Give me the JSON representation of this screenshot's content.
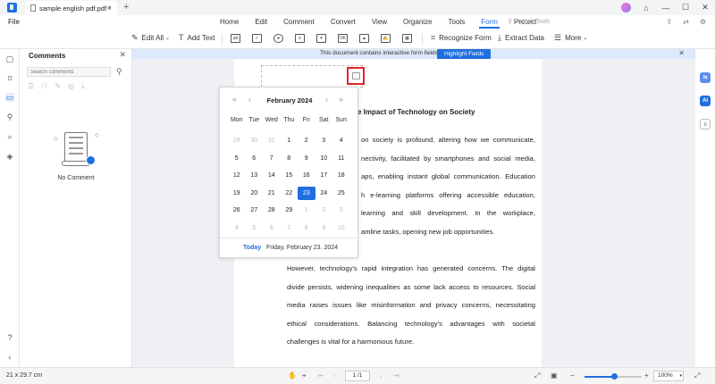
{
  "titlebar": {
    "tab_name": "sample english pdf.pdf *",
    "tab_close": "×",
    "new_tab": "+",
    "min": "—",
    "max": "☐",
    "close": "✕"
  },
  "menubar": {
    "file": "File",
    "items": [
      "Home",
      "Edit",
      "Comment",
      "Convert",
      "View",
      "Organize",
      "Tools",
      "Form",
      "Protect"
    ],
    "active": "Form",
    "search_tools": "Search Tools"
  },
  "toolbar": {
    "edit_all": "Edit All",
    "add_text": "Add Text",
    "recognize_form": "Recognize Form",
    "extract_data": "Extract Data",
    "more": "More"
  },
  "comments_panel": {
    "title": "Comments",
    "search_placeholder": "Search comments",
    "empty_text": "No Comment"
  },
  "infobar": {
    "message": "This document contains interactive form fields.",
    "button": "Highlight Fields"
  },
  "document": {
    "title_fragment": "e Impact of Technology on Society",
    "para1_lines": [
      "on society is profound, altering how we communicate,",
      "nectivity, facilitated by smartphones and social media,",
      "aps, enabling instant global communication. Education",
      "h e-learning platforms offering accessible education,",
      "learning and skill development. In the workplace,",
      "amline tasks, opening new job opportunities."
    ],
    "para2_lines": [
      "However, technology's rapid integration has generated concerns. The digital",
      "divide persists, widening inequalities as some lack access to resources. Social",
      "media raises issues like misinformation and privacy concerns, necessitating",
      "ethical considerations. Balancing technology's advantages with societal",
      "challenges is vital for a harmonious future."
    ]
  },
  "calendar": {
    "month_label": "February 2024",
    "prev_year": "«",
    "prev_month": "‹",
    "next_month": "›",
    "next_year": "»",
    "weekdays": [
      "Mon",
      "Tue",
      "Wed",
      "Thu",
      "Fri",
      "Sat",
      "Sun"
    ],
    "weeks": [
      [
        {
          "d": "29",
          "o": true
        },
        {
          "d": "30",
          "o": true
        },
        {
          "d": "31",
          "o": true
        },
        {
          "d": "1"
        },
        {
          "d": "2"
        },
        {
          "d": "3"
        },
        {
          "d": "4"
        }
      ],
      [
        {
          "d": "5"
        },
        {
          "d": "6"
        },
        {
          "d": "7"
        },
        {
          "d": "8"
        },
        {
          "d": "9"
        },
        {
          "d": "10"
        },
        {
          "d": "11"
        }
      ],
      [
        {
          "d": "12"
        },
        {
          "d": "13"
        },
        {
          "d": "14"
        },
        {
          "d": "15"
        },
        {
          "d": "16"
        },
        {
          "d": "17"
        },
        {
          "d": "18"
        }
      ],
      [
        {
          "d": "19"
        },
        {
          "d": "20"
        },
        {
          "d": "21"
        },
        {
          "d": "22"
        },
        {
          "d": "23",
          "s": true
        },
        {
          "d": "24"
        },
        {
          "d": "25"
        }
      ],
      [
        {
          "d": "26"
        },
        {
          "d": "27"
        },
        {
          "d": "28"
        },
        {
          "d": "29"
        },
        {
          "d": "1",
          "o": true
        },
        {
          "d": "2",
          "o": true
        },
        {
          "d": "3",
          "o": true
        }
      ],
      [
        {
          "d": "4",
          "o": true
        },
        {
          "d": "5",
          "o": true
        },
        {
          "d": "6",
          "o": true
        },
        {
          "d": "7",
          "o": true
        },
        {
          "d": "8",
          "o": true
        },
        {
          "d": "9",
          "o": true
        },
        {
          "d": "10",
          "o": true
        }
      ]
    ],
    "today_label": "Today",
    "selected_date": "Friday, February 23. 2024"
  },
  "statusbar": {
    "page_size": "21 x 29.7 cm",
    "page_field": "1 /1",
    "zoom": "100%",
    "zoom_level": 0.52
  },
  "right_rail": {
    "ai_label": "AI"
  },
  "colors": {
    "accent": "#1f6fe0",
    "highlight_border": "#e0252b"
  }
}
